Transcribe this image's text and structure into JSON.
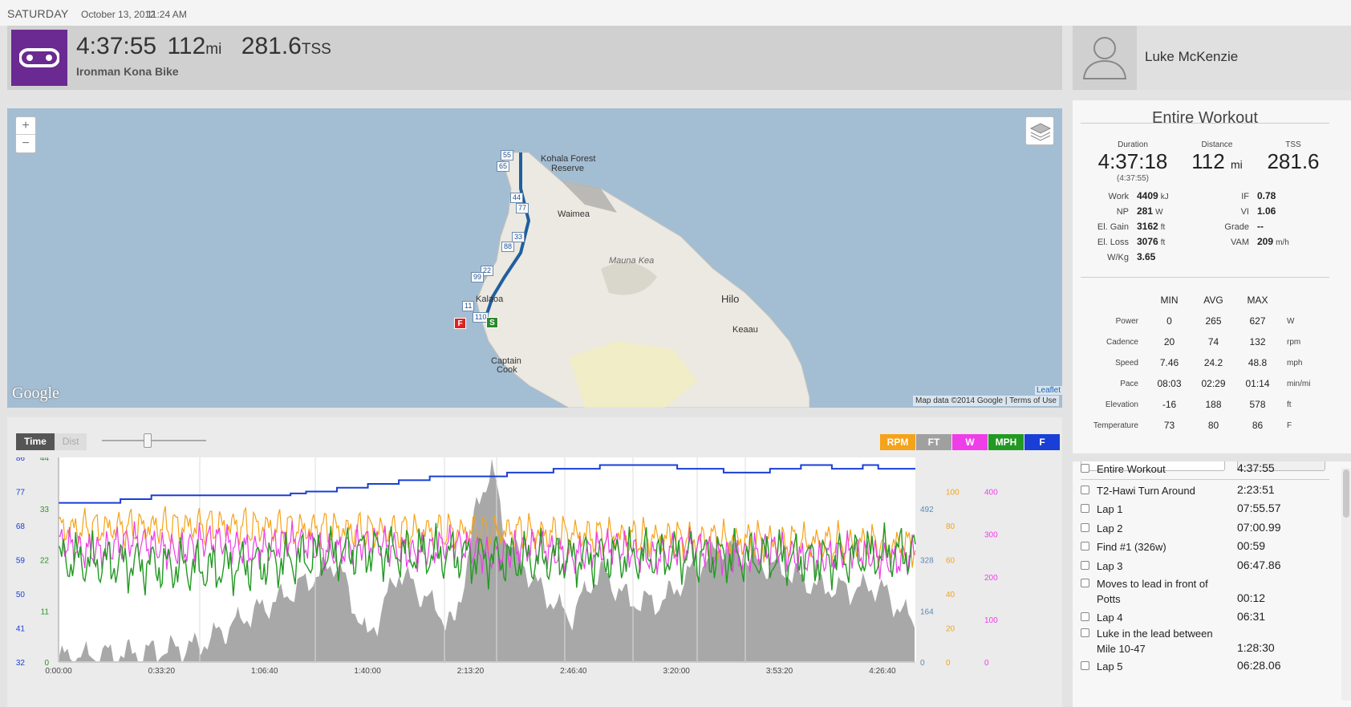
{
  "header": {
    "day": "SATURDAY",
    "date": "October 13, 2012",
    "time": "11:24 AM"
  },
  "workout": {
    "duration": "4:37:55",
    "distance": "112",
    "distance_unit": "mi",
    "tss": "281.6",
    "tss_unit": "TSS",
    "title": "Ironman Kona Bike",
    "icon": "bike-chain-icon",
    "icon_color": "#6a2a91"
  },
  "athlete": {
    "name": "Luke McKenzie",
    "avatar_icon": "user-silhouette-icon"
  },
  "map": {
    "zoom_in": "+",
    "zoom_out": "−",
    "labels": [
      "Kohala Forest",
      "Reserve",
      "Waimea",
      "Mauna Kea",
      "Kalaoa",
      "Hilo",
      "Keaau",
      "Captain",
      "Cook"
    ],
    "markers": [
      "55",
      "65",
      "44",
      "77",
      "33",
      "88",
      "22",
      "99",
      "11",
      "110"
    ],
    "start_label": "S",
    "finish_label": "F",
    "google": "Google",
    "attribution": "Map data ©2014 Google",
    "terms": "Terms of Use",
    "leaflet": "Leaflet"
  },
  "summary": {
    "title": "Entire Workout",
    "duration_label": "Duration",
    "duration": "4:37:18",
    "duration_sub": "(4:37:55)",
    "distance_label": "Distance",
    "distance": "112",
    "distance_unit": "mi",
    "tss_label": "TSS",
    "tss": "281.6",
    "left_metrics": [
      {
        "k": "Work",
        "v": "4409",
        "u": "kJ"
      },
      {
        "k": "NP",
        "v": "281",
        "u": "W"
      },
      {
        "k": "El. Gain",
        "v": "3162",
        "u": "ft"
      },
      {
        "k": "El. Loss",
        "v": "3076",
        "u": "ft"
      },
      {
        "k": "W/Kg",
        "v": "3.65",
        "u": ""
      }
    ],
    "right_metrics": [
      {
        "k": "IF",
        "v": "0.78",
        "u": ""
      },
      {
        "k": "VI",
        "v": "1.06",
        "u": ""
      },
      {
        "k": "Grade",
        "v": "--",
        "u": ""
      },
      {
        "k": "VAM",
        "v": "209",
        "u": "m/h"
      }
    ],
    "table_headers": [
      "MIN",
      "AVG",
      "MAX"
    ],
    "table_rows": [
      {
        "name": "Power",
        "min": "0",
        "avg": "265",
        "max": "627",
        "unit": "W"
      },
      {
        "name": "Cadence",
        "min": "20",
        "avg": "74",
        "max": "132",
        "unit": "rpm"
      },
      {
        "name": "Speed",
        "min": "7.46",
        "avg": "24.2",
        "max": "48.8",
        "unit": "mph"
      },
      {
        "name": "Pace",
        "min": "08:03",
        "avg": "02:29",
        "max": "01:14",
        "unit": "min/mi"
      },
      {
        "name": "Elevation",
        "min": "-16",
        "avg": "188",
        "max": "578",
        "unit": "ft"
      },
      {
        "name": "Temperature",
        "min": "73",
        "avg": "80",
        "max": "86",
        "unit": "F"
      }
    ]
  },
  "laps": [
    {
      "name": "Entire Workout",
      "time": "4:37:55"
    },
    {
      "name": "T2-Hawi Turn Around",
      "time": "2:23:51"
    },
    {
      "name": "Lap 1",
      "time": "07:55.57"
    },
    {
      "name": "Lap 2",
      "time": "07:00.99"
    },
    {
      "name": "Find #1 (326w)",
      "time": "00:59"
    },
    {
      "name": "Lap 3",
      "time": "06:47.86"
    },
    {
      "name": "Moves to lead in front of Potts",
      "time": "00:12"
    },
    {
      "name": "Lap 4",
      "time": "06:31"
    },
    {
      "name": "Luke in the lead between Mile 10-47",
      "time": "1:28:30"
    },
    {
      "name": "Lap 5",
      "time": "06:28.06"
    }
  ],
  "chart_controls": {
    "time_label": "Time",
    "dist_label": "Dist",
    "legend": [
      {
        "label": "RPM",
        "color": "#f5a31a"
      },
      {
        "label": "FT",
        "color": "#a0a0a0"
      },
      {
        "label": "W",
        "color": "#ee3ee8"
      },
      {
        "label": "MPH",
        "color": "#229922"
      },
      {
        "label": "F",
        "color": "#1a3fd6"
      }
    ]
  },
  "chart_data": {
    "type": "line",
    "x_ticks": [
      "0:00:00",
      "0:33:20",
      "1:06:40",
      "1:40:00",
      "2:13:20",
      "2:46:40",
      "3:20:00",
      "3:53:20",
      "4:26:40"
    ],
    "axes": {
      "temperature_F": {
        "ticks": [
          "86",
          "77",
          "68",
          "59",
          "50",
          "41",
          "32"
        ],
        "range": [
          32,
          86
        ],
        "color": "#1a3fd6"
      },
      "speed_mph": {
        "ticks": [
          "44",
          "33",
          "22",
          "11",
          "0"
        ],
        "range": [
          0,
          44
        ],
        "color": "#229922"
      },
      "elevation_ft": {
        "ticks": [
          "492",
          "328",
          "164",
          "0"
        ],
        "range": [
          0,
          656
        ],
        "color": "#5a8ab8"
      },
      "cadence_rpm": {
        "ticks": [
          "100",
          "80",
          "60",
          "40",
          "20",
          "0"
        ],
        "range": [
          0,
          120
        ],
        "color": "#f5a31a"
      },
      "power_W": {
        "ticks": [
          "400",
          "300",
          "200",
          "100",
          "0"
        ],
        "range": [
          0,
          480
        ],
        "color": "#ee3ee8"
      }
    },
    "series": [
      {
        "name": "FT",
        "unit": "ft",
        "x_min": [
          0,
          15,
          30,
          45,
          60,
          75,
          90,
          95,
          100,
          110,
          120,
          128,
          135,
          140,
          145,
          155,
          165,
          175,
          185,
          195,
          205,
          215,
          225,
          235,
          245,
          255,
          265,
          277
        ],
        "values": [
          20,
          30,
          40,
          60,
          150,
          230,
          330,
          200,
          80,
          300,
          200,
          120,
          500,
          640,
          400,
          250,
          150,
          300,
          200,
          200,
          300,
          380,
          330,
          300,
          250,
          240,
          250,
          130
        ]
      },
      {
        "name": "F",
        "unit": "F",
        "x_min": [
          0,
          10,
          20,
          30,
          60,
          75,
          80,
          90,
          100,
          110,
          120,
          135,
          145,
          160,
          175,
          185,
          200,
          215,
          230,
          240,
          250,
          260,
          265,
          277
        ],
        "values": [
          74,
          74,
          75,
          76,
          76,
          76.5,
          77,
          78,
          79,
          80,
          81,
          81,
          82,
          83,
          84,
          84,
          83,
          82,
          83,
          84,
          83,
          84,
          83,
          83
        ]
      },
      {
        "name": "RPM",
        "unit": "rpm",
        "x_min": [
          0,
          50,
          100,
          150,
          200,
          250,
          277
        ],
        "values": [
          78,
          80,
          77,
          76,
          72,
          70,
          68
        ]
      },
      {
        "name": "MPH",
        "unit": "mph",
        "x_min": [
          0,
          50,
          100,
          150,
          200,
          250,
          277
        ],
        "values": [
          22,
          20,
          24,
          22,
          23,
          22,
          24
        ]
      },
      {
        "name": "W",
        "unit": "W",
        "x_min": [
          0,
          50,
          100,
          150,
          200,
          250,
          277
        ],
        "values": [
          270,
          275,
          270,
          260,
          260,
          250,
          250
        ]
      }
    ]
  }
}
